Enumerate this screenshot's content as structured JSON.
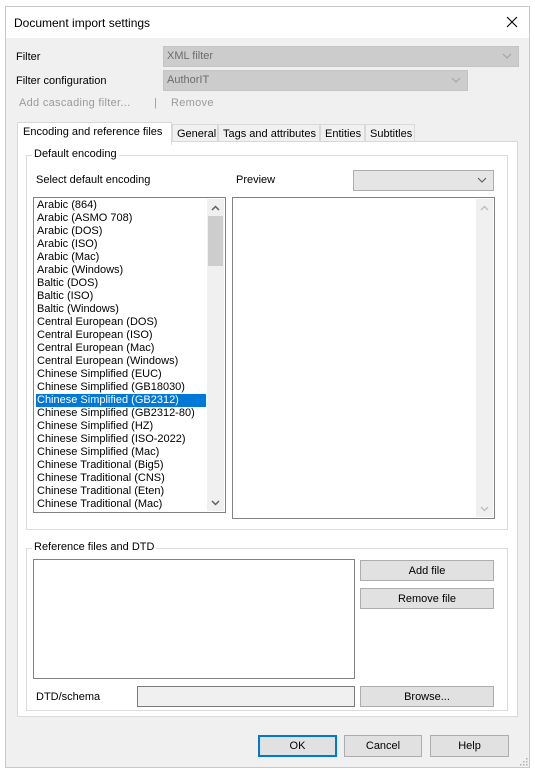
{
  "window": {
    "title": "Document import settings",
    "close_icon": "close-icon"
  },
  "filter": {
    "label": "Filter",
    "value": "XML filter",
    "disabled": true
  },
  "filter_configuration": {
    "label": "Filter configuration",
    "value": "AuthorIT",
    "disabled": true
  },
  "cascade": {
    "add_label": "Add cascading filter...",
    "separator": "|",
    "remove_label": "Remove"
  },
  "tabs": [
    {
      "label": "Encoding and reference files",
      "active": true
    },
    {
      "label": "General",
      "active": false
    },
    {
      "label": "Tags and attributes",
      "active": false
    },
    {
      "label": "Entities",
      "active": false
    },
    {
      "label": "Subtitles",
      "active": false
    }
  ],
  "default_encoding": {
    "group_label": "Default encoding",
    "select_label": "Select default encoding",
    "preview_label": "Preview",
    "preview_value": "",
    "selected": "Chinese Simplified (GB2312)",
    "items": [
      "Arabic (864)",
      "Arabic (ASMO 708)",
      "Arabic (DOS)",
      "Arabic (ISO)",
      "Arabic (Mac)",
      "Arabic (Windows)",
      "Baltic (DOS)",
      "Baltic (ISO)",
      "Baltic (Windows)",
      "Central European (DOS)",
      "Central European (ISO)",
      "Central European (Mac)",
      "Central European (Windows)",
      "Chinese Simplified (EUC)",
      "Chinese Simplified (GB18030)",
      "Chinese Simplified (GB2312)",
      "Chinese Simplified (GB2312-80)",
      "Chinese Simplified (HZ)",
      "Chinese Simplified (ISO-2022)",
      "Chinese Simplified (Mac)",
      "Chinese Traditional (Big5)",
      "Chinese Traditional (CNS)",
      "Chinese Traditional (Eten)",
      "Chinese Traditional (Mac)"
    ]
  },
  "reference_files": {
    "group_label": "Reference files and DTD",
    "add_file_label": "Add file",
    "remove_file_label": "Remove file",
    "dtd_label": "DTD/schema",
    "dtd_value": "",
    "browse_label": "Browse..."
  },
  "footer": {
    "ok_label": "OK",
    "cancel_label": "Cancel",
    "help_label": "Help"
  },
  "colors": {
    "selection": "#0078d7",
    "dialog_bg": "#f0f0f0",
    "disabled_text": "#9a9a9a"
  }
}
